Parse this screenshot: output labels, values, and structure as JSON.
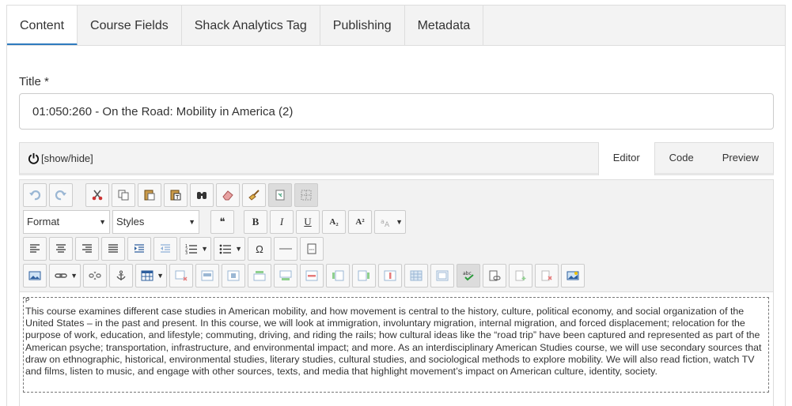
{
  "tabs": [
    {
      "label": "Content",
      "active": true
    },
    {
      "label": "Course Fields",
      "active": false
    },
    {
      "label": "Shack Analytics Tag",
      "active": false
    },
    {
      "label": "Publishing",
      "active": false
    },
    {
      "label": "Metadata",
      "active": false
    }
  ],
  "title_field": {
    "label": "Title *",
    "value": "01:050:260 - On the Road: Mobility in America (2)"
  },
  "editor": {
    "show_hide_label": "[show/hide]",
    "modes": [
      "Editor",
      "Code",
      "Preview"
    ],
    "active_mode": "Editor",
    "format_combo": "Format",
    "styles_combo": "Styles",
    "element_tag": "P",
    "body_text": "This course examines different case studies in American mobility, and how movement is central to the history, culture, political economy, and social organization of the United States – in the past and present. In this course, we will look at immigration, involuntary migration, internal migration, and forced displacement; relocation for the purpose of work, education, and lifestyle; commuting, driving, and riding the rails; how cultural ideas like the “road trip” have been captured and represented as part of the American psyche; transportation, infrastructure, and environmental impact; and more. As an interdisciplinary American Studies course, we will use secondary sources that draw on ethnographic, historical, environmental studies, literary studies, cultural studies, and sociological methods to explore mobility. We will also read fiction, watch TV and films, listen to music, and engage with other sources, texts, and media that highlight movement’s impact on American culture, identity, society."
  },
  "toolbar_glyphs": {
    "bold": "B",
    "italic": "I",
    "underline": "U",
    "subscript": "A₂",
    "superscript": "A²",
    "quote": "❝",
    "omega": "Ω"
  },
  "colors": {
    "active_tab_underline": "#2e7bbf",
    "panel_bg": "#f3f3f3",
    "border": "#dddddd"
  }
}
